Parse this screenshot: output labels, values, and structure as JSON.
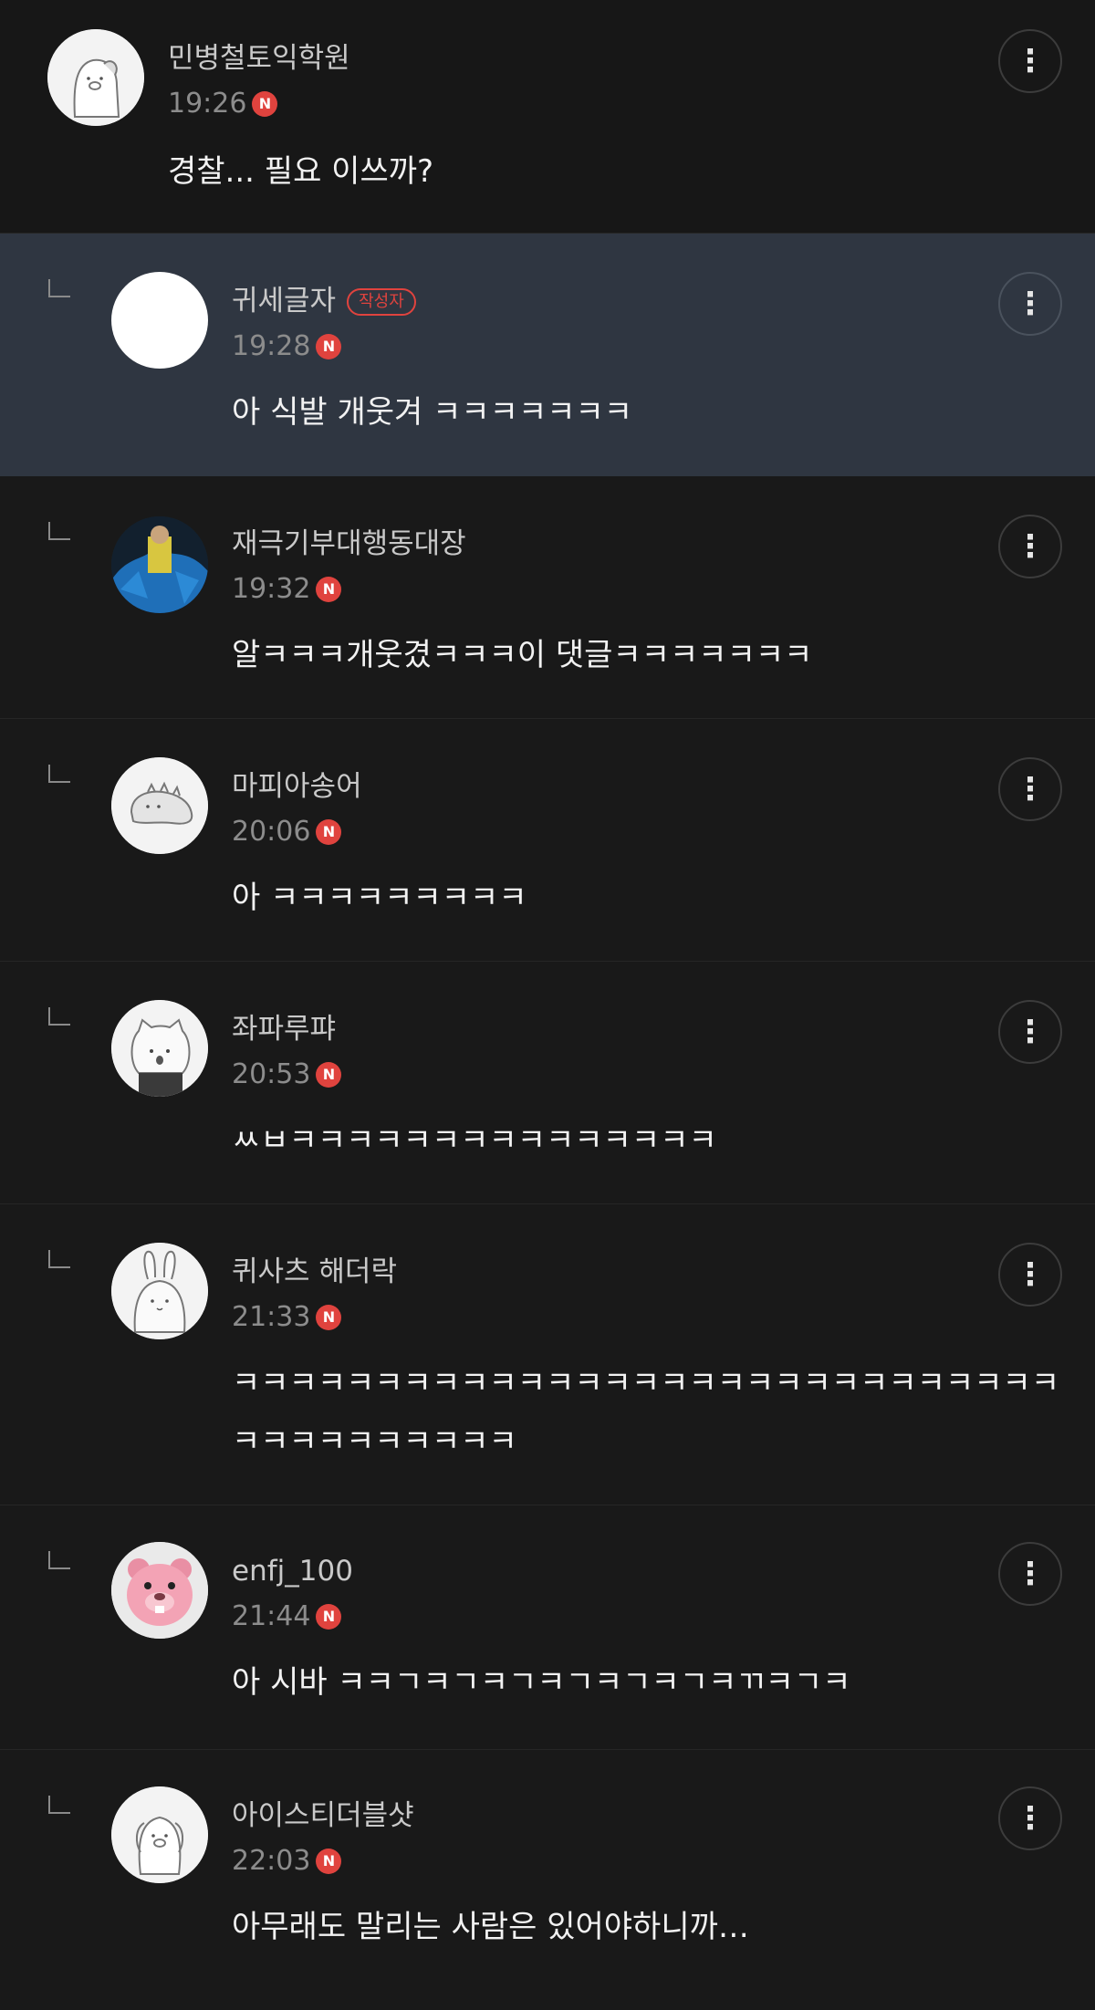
{
  "new_badge": "N",
  "comments": [
    {
      "username": "민병철토익학원",
      "time": "19:26",
      "text": "경찰... 필요 이쓰까?",
      "avatar_icon": "dog-avatar-icon"
    },
    {
      "username": "귀세글자",
      "author_badge": "작성자",
      "time": "19:28",
      "text": "아 식발 개웃겨 ㅋㅋㅋㅋㅋㅋㅋ",
      "avatar_icon": "blank-avatar-icon"
    },
    {
      "username": "재극기부대행동대장",
      "time": "19:32",
      "text": "알ㅋㅋㅋ개웃겼ㅋㅋㅋ이 댓글ㅋㅋㅋㅋㅋㅋㅋ",
      "avatar_icon": "photo-avatar-icon"
    },
    {
      "username": "마피아송어",
      "time": "20:06",
      "text": "아 ㅋㅋㅋㅋㅋㅋㅋㅋㅋ",
      "avatar_icon": "dinosaur-avatar-icon"
    },
    {
      "username": "좌파루퍄",
      "time": "20:53",
      "text": "ㅆㅂㅋㅋㅋㅋㅋㅋㅋㅋㅋㅋㅋㅋㅋㅋㅋ",
      "avatar_icon": "cat-avatar-icon"
    },
    {
      "username": "퀴사츠 해더락",
      "time": "21:33",
      "text": "ㅋㅋㅋㅋㅋㅋㅋㅋㅋㅋㅋㅋㅋㅋㅋㅋㅋㅋㅋㅋㅋㅋㅋㅋㅋㅋㅋㅋㅋㅋㅋㅋㅋㅋㅋㅋㅋㅋㅋ",
      "avatar_icon": "rabbit-avatar-icon"
    },
    {
      "username": "enfj_100",
      "time": "21:44",
      "text": "아 시바 ㅋㅋㄱㅋㄱㅋㄱㅋㄱㅋㄱㅋㄱㅋㄲㅋㄱㅋ",
      "avatar_icon": "pink-beaver-avatar-icon"
    },
    {
      "username": "아이스티더블샷",
      "time": "22:03",
      "text": "아무래도 말리는 사람은 있어야하니까…",
      "avatar_icon": "dog-avatar-icon"
    }
  ]
}
